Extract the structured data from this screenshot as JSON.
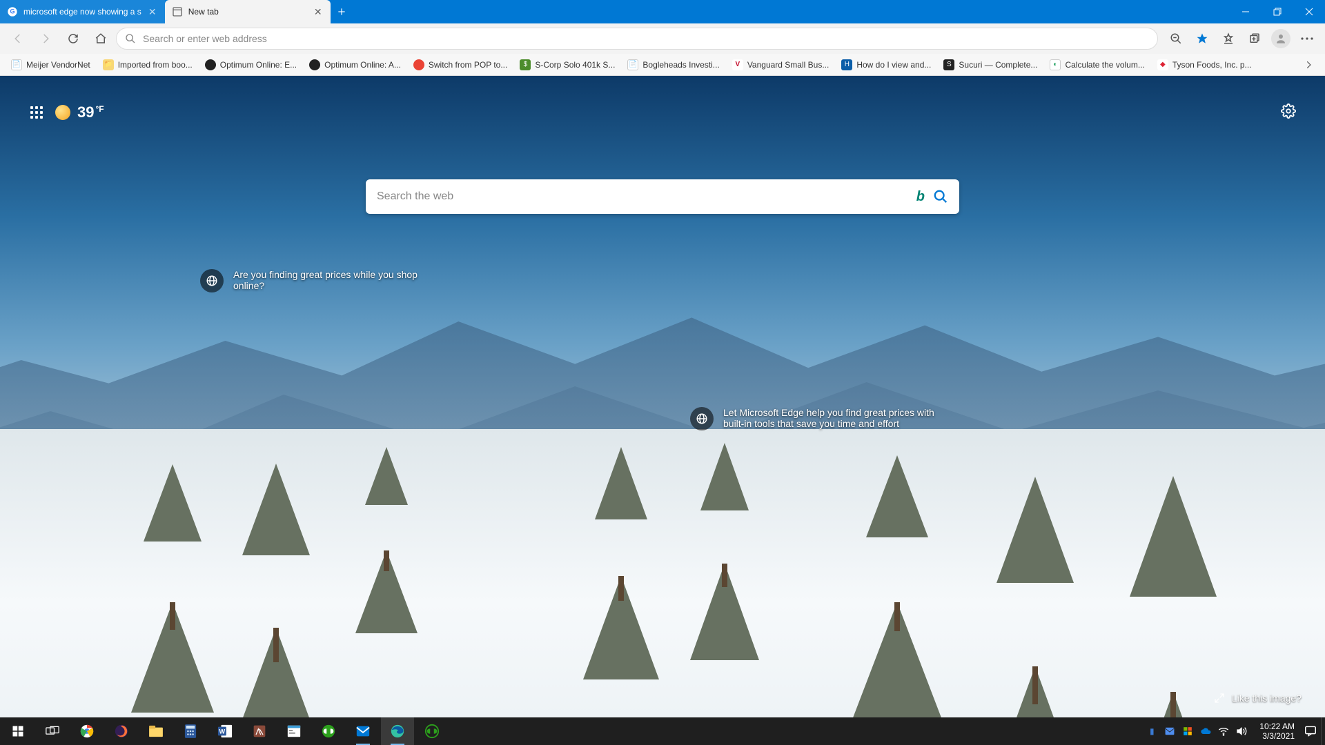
{
  "tabs": [
    {
      "title": "microsoft edge now showing a s",
      "active": false
    },
    {
      "title": "New tab",
      "active": true
    }
  ],
  "addressbar": {
    "placeholder": "Search or enter web address"
  },
  "bookmarks": [
    {
      "label": "Meijer VendorNet",
      "icon": "doc",
      "color": "#fff"
    },
    {
      "label": "Imported from boo...",
      "icon": "folder",
      "color": "#f8d775"
    },
    {
      "label": "Optimum Online: E...",
      "icon": "dot",
      "color": "#222"
    },
    {
      "label": "Optimum Online: A...",
      "icon": "dot",
      "color": "#222"
    },
    {
      "label": "Switch from POP to...",
      "icon": "dot",
      "color": "#ea4335"
    },
    {
      "label": "S-Corp Solo 401k S...",
      "icon": "sq",
      "color": "#4c8c2b"
    },
    {
      "label": "Bogleheads Investi...",
      "icon": "doc",
      "color": "#fff"
    },
    {
      "label": "Vanguard Small Bus...",
      "icon": "v",
      "color": "#c40f2d"
    },
    {
      "label": "How do I view and...",
      "icon": "sq",
      "color": "#0b5ea8"
    },
    {
      "label": "Sucuri — Complete...",
      "icon": "sq",
      "color": "#222"
    },
    {
      "label": "Calculate the volum...",
      "icon": "dot",
      "color": "#1a9e5c"
    },
    {
      "label": "Tyson Foods, Inc. p...",
      "icon": "dot",
      "color": "#d23"
    }
  ],
  "ntp": {
    "temp_value": "39",
    "temp_unit": "°F",
    "search_placeholder": "Search the web",
    "bubble1": "Are you finding great prices while you shop online?",
    "bubble2": "Let Microsoft Edge help you find great prices with built-in tools that save you time and effort",
    "like_label": "Like this image?"
  },
  "clock": {
    "time": "10:22 AM",
    "date": "3/3/2021"
  }
}
